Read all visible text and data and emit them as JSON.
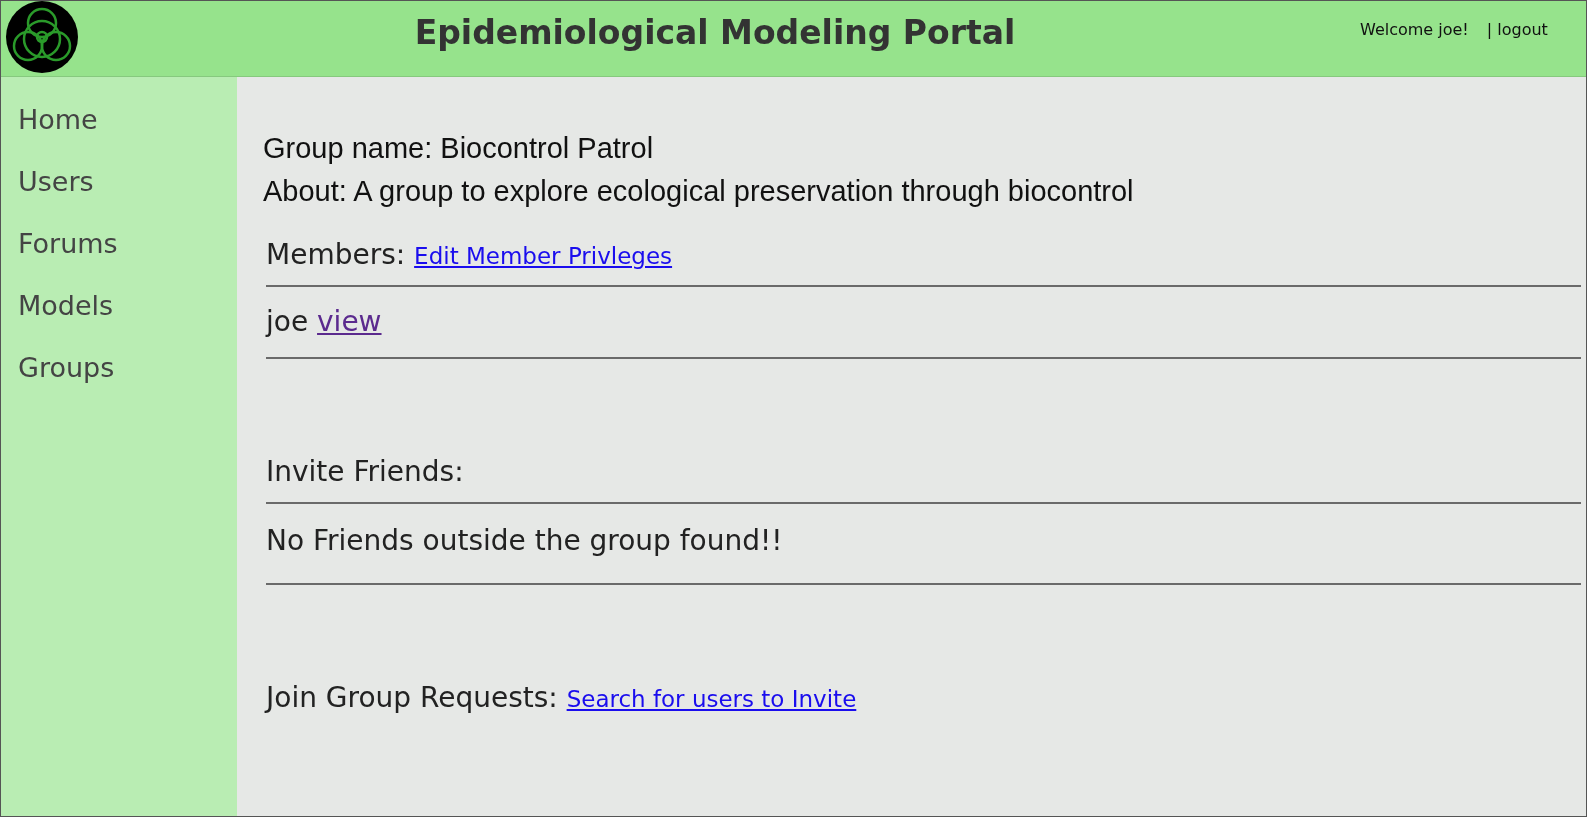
{
  "header": {
    "title": "Epidemiological Modeling Portal",
    "welcome": "Welcome joe!",
    "logout": "| logout"
  },
  "sidebar": {
    "items": [
      {
        "label": "Home"
      },
      {
        "label": "Users"
      },
      {
        "label": "Forums"
      },
      {
        "label": "Models"
      },
      {
        "label": "Groups"
      }
    ]
  },
  "group": {
    "name_line": "Group name: Biocontrol Patrol",
    "about_line": "About: A group to explore ecological preservation through biocontrol"
  },
  "members": {
    "label": "Members:",
    "link": "Edit Member Privleges",
    "rows": [
      {
        "name": "joe",
        "link": "view",
        "visited": true
      }
    ]
  },
  "invite": {
    "label": "Invite Friends:",
    "message": "No Friends outside the group found!!"
  },
  "join_requests": {
    "label": "Join Group Requests:",
    "link": "Search for users to Invite"
  }
}
